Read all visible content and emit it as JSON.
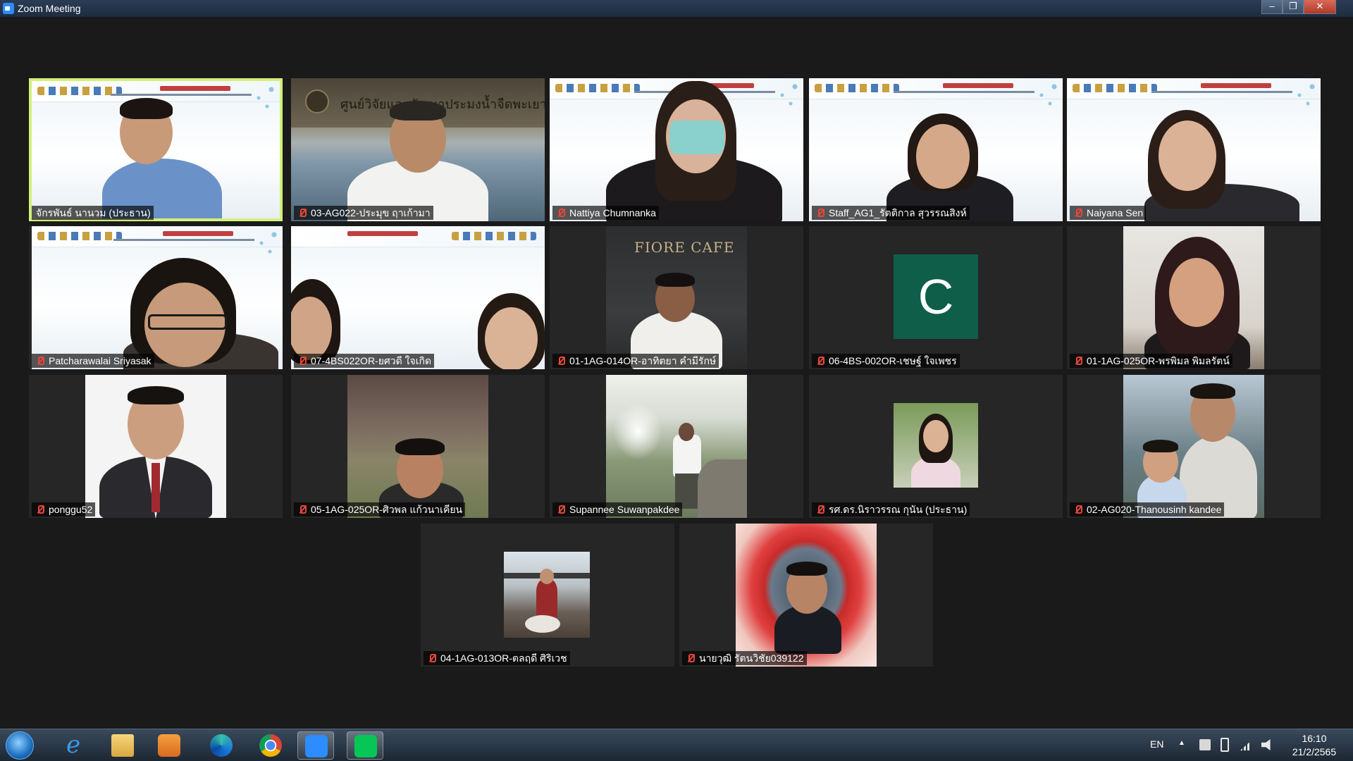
{
  "window": {
    "title": "Zoom Meeting",
    "minimize": "–",
    "maximize": "❐",
    "close": "✕"
  },
  "participants": [
    {
      "name": "จักรพันธ์ นานวม (ประธาน)",
      "muted": false,
      "active": true
    },
    {
      "name": "03-AG022-ประมุข ฤาเก้ามา",
      "muted": true
    },
    {
      "name": "Nattiya Chumnanka",
      "muted": true
    },
    {
      "name": "Staff_AG1_รัตติกาล สุวรรณสิงห์",
      "muted": true
    },
    {
      "name": "Naiyana Sen",
      "muted": true
    },
    {
      "name": "Patcharawalai Sriyasak",
      "muted": true
    },
    {
      "name": "07-4BS022OR-ยศวดี ใจเกิด",
      "muted": true
    },
    {
      "name": "01-1AG-014OR-อาทิตยา คำมีรักษ์",
      "muted": true
    },
    {
      "name": "06-4BS-002OR-เชษฐ์ ใจเพชร",
      "muted": true,
      "avatar_letter": "C"
    },
    {
      "name": "01-1AG-025OR-พรพิมล พิมลรัตน์",
      "muted": true
    },
    {
      "name": "ponggu52",
      "muted": true
    },
    {
      "name": "05-1AG-025OR-ศิวพล แก้วนาเคียน",
      "muted": true
    },
    {
      "name": "Supannee Suwanpakdee",
      "muted": true
    },
    {
      "name": "รศ.ดร.นิราวรรณ กุนัน (ประธาน)",
      "muted": true
    },
    {
      "name": "02-AG020-Thanousinh kandee",
      "muted": true
    },
    {
      "name": "04-1AG-013OR-ตลฤดี ศิริเวช",
      "muted": true
    },
    {
      "name": "นายวุฒิ รัตนวิชัย039122",
      "muted": true
    }
  ],
  "video_text": {
    "cafe_sign": "FIORE CAFE",
    "lab_sign": "ศูนย์วิจัยและพัฒนาประมงน้ำจืดพะเยา"
  },
  "taskbar": {
    "language": "EN",
    "tray_arrow": "▲",
    "time": "16:10",
    "date": "21/2/2565"
  }
}
